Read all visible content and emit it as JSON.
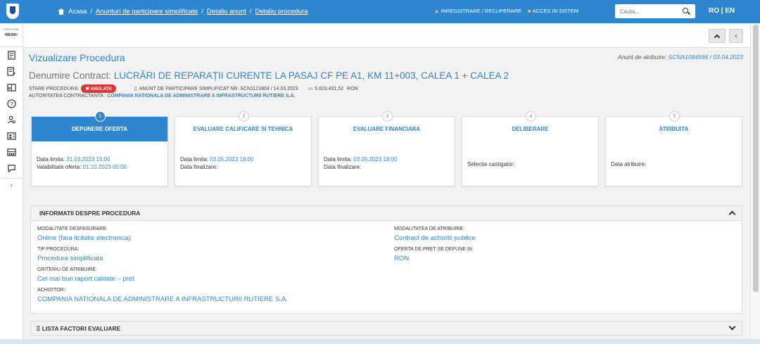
{
  "nav": {
    "breadcrumbs": [
      "Acasa",
      "Anunturi de participare simplificate",
      "Detaliu anunt",
      "Detaliu procedura"
    ],
    "register": "INREGISTRARE / RECUPERARE",
    "login": "ACCES IN SISTEM",
    "search_placeholder": "Cauta...",
    "language": "RO | EN"
  },
  "sidebar": {
    "menu_small": "SPRINGTIME",
    "menu_label": "MENIU",
    "icons": [
      "document-icon",
      "list-icon",
      "book-icon",
      "help-icon",
      "user-search-icon",
      "id-card-icon",
      "building-icon",
      "chat-icon"
    ]
  },
  "page": {
    "title": "Vizualizare Procedura",
    "anunt_label": "Anunt de atribuire:",
    "anunt_value": "SCNA1084566 / 03.04.2023",
    "contract_label": "Denumire Contract:",
    "contract_value": "LUCRĂRI DE REPARAȚII CURENTE LA PASAJ CF PE A1, KM 11+003, CALEA 1 + CALEA 2",
    "stare_label": "STARE PROCEDURA:",
    "stare_value": "ANULATA",
    "anunt_participare": "ANUNT DE PARTICIPARE SIMPLIFICAT NR. SCN1121804 / 14.03.2023",
    "valoare": "5.823.431,52",
    "moneda": "RON",
    "autoritate_label": "AUTORITATEA CONTRACTANTA :",
    "autoritate_value": "COMPANIA NATIONALA DE ADMINISTRARE A INFRASTRUCTURII RUTIERE S.A."
  },
  "steps": [
    {
      "num": "1",
      "title": "DEPUNERE OFERTA",
      "lines": [
        {
          "label": "Data limita:",
          "value": "31.03.2023 15:00"
        },
        {
          "label": "Valabilitate oferta:",
          "value": "01.10.2023 00:00"
        }
      ]
    },
    {
      "num": "2",
      "title": "EVALUARE CALIFICARE SI TEHNICA",
      "lines": [
        {
          "label": "Data limita:",
          "value": "03.05.2023 18:00"
        },
        {
          "label": "Data finalizare:",
          "value": ""
        }
      ]
    },
    {
      "num": "3",
      "title": "EVALUARE FINANCIARA",
      "lines": [
        {
          "label": "Data limita:",
          "value": "03.05.2023 18:00"
        },
        {
          "label": "Data finalizare:",
          "value": ""
        }
      ]
    },
    {
      "num": "4",
      "title": "DELIBERARE",
      "lines": [
        {
          "label": "Selectie castigator:",
          "value": ""
        }
      ]
    },
    {
      "num": "5",
      "title": "ATRIBUITA",
      "lines": [
        {
          "label": "Data atribuire:",
          "value": ""
        }
      ]
    }
  ],
  "info": {
    "title": "INFORMATII DESPRE PROCEDURA",
    "modalitate_desfasurare_label": "MODALITATE DESFASURARE:",
    "modalitate_desfasurare_value": "Online (fara licitatie electronica)",
    "tip_procedura_label": "TIP PROCEDURA:",
    "tip_procedura_value": "Procedura simplificata",
    "criteriu_label": "CRITERIU DE ATRIBUIRE:",
    "criteriu_value": "Cel mai bun raport calitate – pret",
    "achizitor_label": "ACHIZITOR:",
    "achizitor_value": "COMPANIA NATIONALA DE ADMINISTRARE A INFRASTRUCTURII RUTIERE S.A.",
    "modalitate_atribuire_label": "MODALITATEA DE ATRIBUIRE:",
    "modalitate_atribuire_value": "Contract de achizitii publice",
    "oferta_label": "OFERTA DE PRET SE DEPUNE IN:",
    "oferta_value": "RON"
  },
  "factori": {
    "title": "LISTA FACTORI EVALUARE"
  }
}
